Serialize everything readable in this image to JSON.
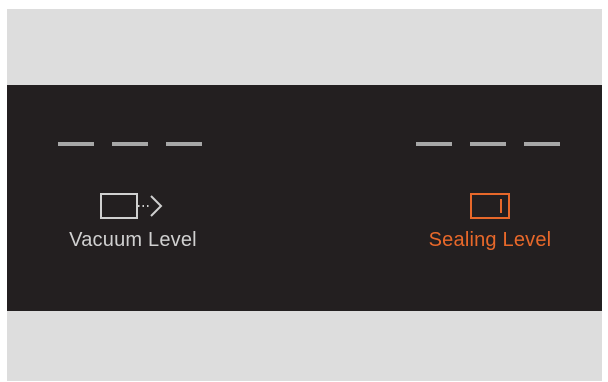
{
  "vacuum": {
    "label": "Vacuum Level",
    "level_display": "– – –",
    "icon": "vacuum-arrow-icon",
    "color": "#d0d0d0"
  },
  "sealing": {
    "label": "Sealing Level",
    "level_display": "– – –",
    "icon": "seal-bar-icon",
    "color": "#e8682a"
  },
  "colors": {
    "panel_background": "#231f20",
    "frame_background": "#dddddd",
    "dash": "#a7a7a7",
    "active": "#e8682a"
  }
}
